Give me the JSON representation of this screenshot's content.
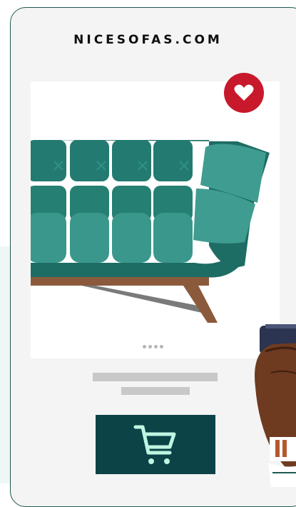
{
  "site": {
    "title": "NICESOFAS.COM"
  },
  "product": {
    "image_icon": "sofa-illustration",
    "favorite_icon": "heart-icon",
    "carousel_dot_count": 4,
    "cart_icon": "shopping-cart-icon"
  },
  "colors": {
    "accent_teal": "#2a8f80",
    "favorite_red": "#c8182b",
    "cart_button": "#0b4347",
    "cart_icon": "#bff5e2",
    "frame_border": "#1d5b53"
  }
}
